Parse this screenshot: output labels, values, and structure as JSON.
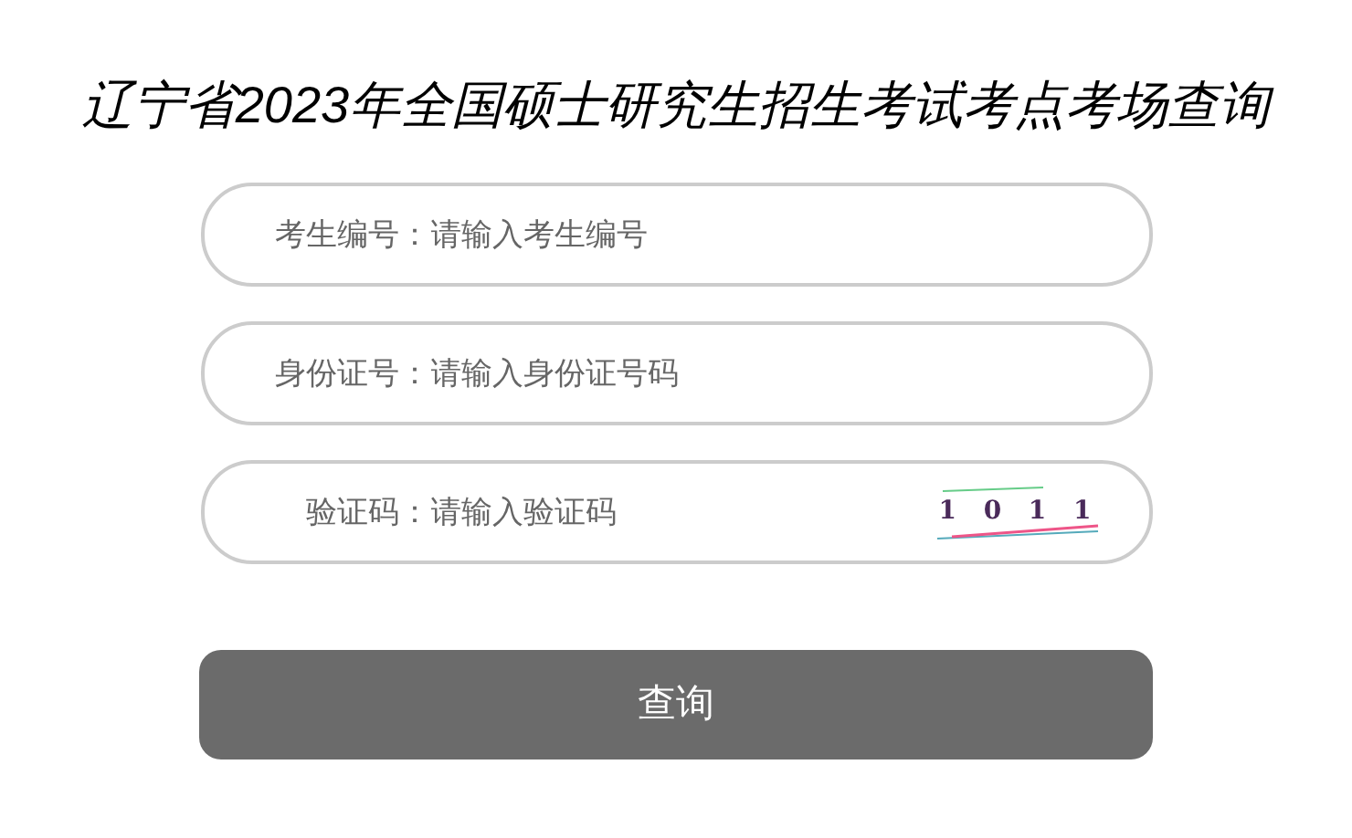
{
  "title": "辽宁省2023年全国硕士研究生招生考试考点考场查询",
  "fields": [
    {
      "label": "考生编号：",
      "placeholder": "请输入考生编号"
    },
    {
      "label": "身份证号：",
      "placeholder": "请输入身份证号码"
    },
    {
      "label": "验证码：",
      "placeholder": "请输入验证码",
      "captcha": "1 0 1 1"
    }
  ],
  "button": "查询"
}
